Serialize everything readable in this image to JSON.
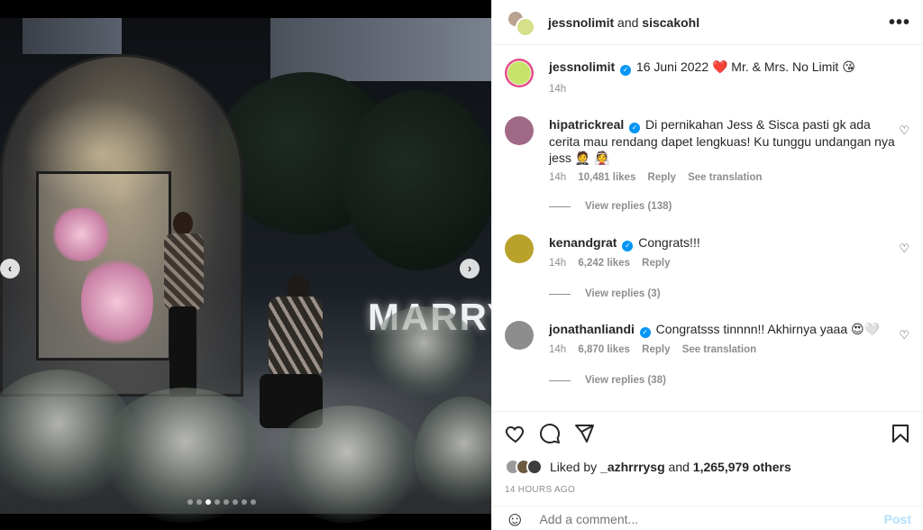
{
  "post": {
    "header": {
      "user1": "jessnolimit",
      "joiner": "and",
      "user2": "siscakohl"
    },
    "caption": {
      "username": "jessnolimit",
      "text": "16 Juni 2022 ❤️ Mr. & Mrs. No Limit 😘",
      "time": "14h"
    },
    "photo": {
      "sign_text": "MARRY",
      "slide_count": 8,
      "active_slide": 2,
      "prev_glyph": "‹",
      "next_glyph": "›"
    },
    "comments": [
      {
        "username": "hipatrickreal",
        "verified": true,
        "text": "Di pernikahan Jess & Sisca pasti gk ada cerita mau rendang dapet lengkuas! Ku tunggu undangan nya jess 🤵 👰",
        "time": "14h",
        "likes": "10,481 likes",
        "reply": "Reply",
        "translation": "See translation",
        "view_replies": "View replies (138)"
      },
      {
        "username": "kenandgrat",
        "verified": true,
        "text": "Congrats!!!",
        "time": "14h",
        "likes": "6,242 likes",
        "reply": "Reply",
        "view_replies": "View replies (3)"
      },
      {
        "username": "jonathanliandi",
        "verified": true,
        "text": "Congratsss tinnnn!! Akhirnya yaaa 😍🤍",
        "time": "14h",
        "likes": "6,870 likes",
        "reply": "Reply",
        "translation": "See translation",
        "view_replies": "View replies (38)"
      }
    ],
    "likes": {
      "prefix": "Liked by",
      "user": "_azhrrrysg",
      "joiner": "and",
      "count": "1,265,979 others"
    },
    "time_ago": "14 HOURS AGO",
    "add_comment": {
      "placeholder": "Add a comment...",
      "post_label": "Post"
    },
    "icons": {
      "more": "more-icon",
      "like": "heart-icon",
      "comment": "comment-icon",
      "share": "share-icon",
      "save": "bookmark-icon",
      "emoji": "smile-icon"
    },
    "colors": {
      "link_blue": "#0095f6",
      "post_disabled": "#b2dffc",
      "meta_gray": "#8e8e8e"
    }
  }
}
